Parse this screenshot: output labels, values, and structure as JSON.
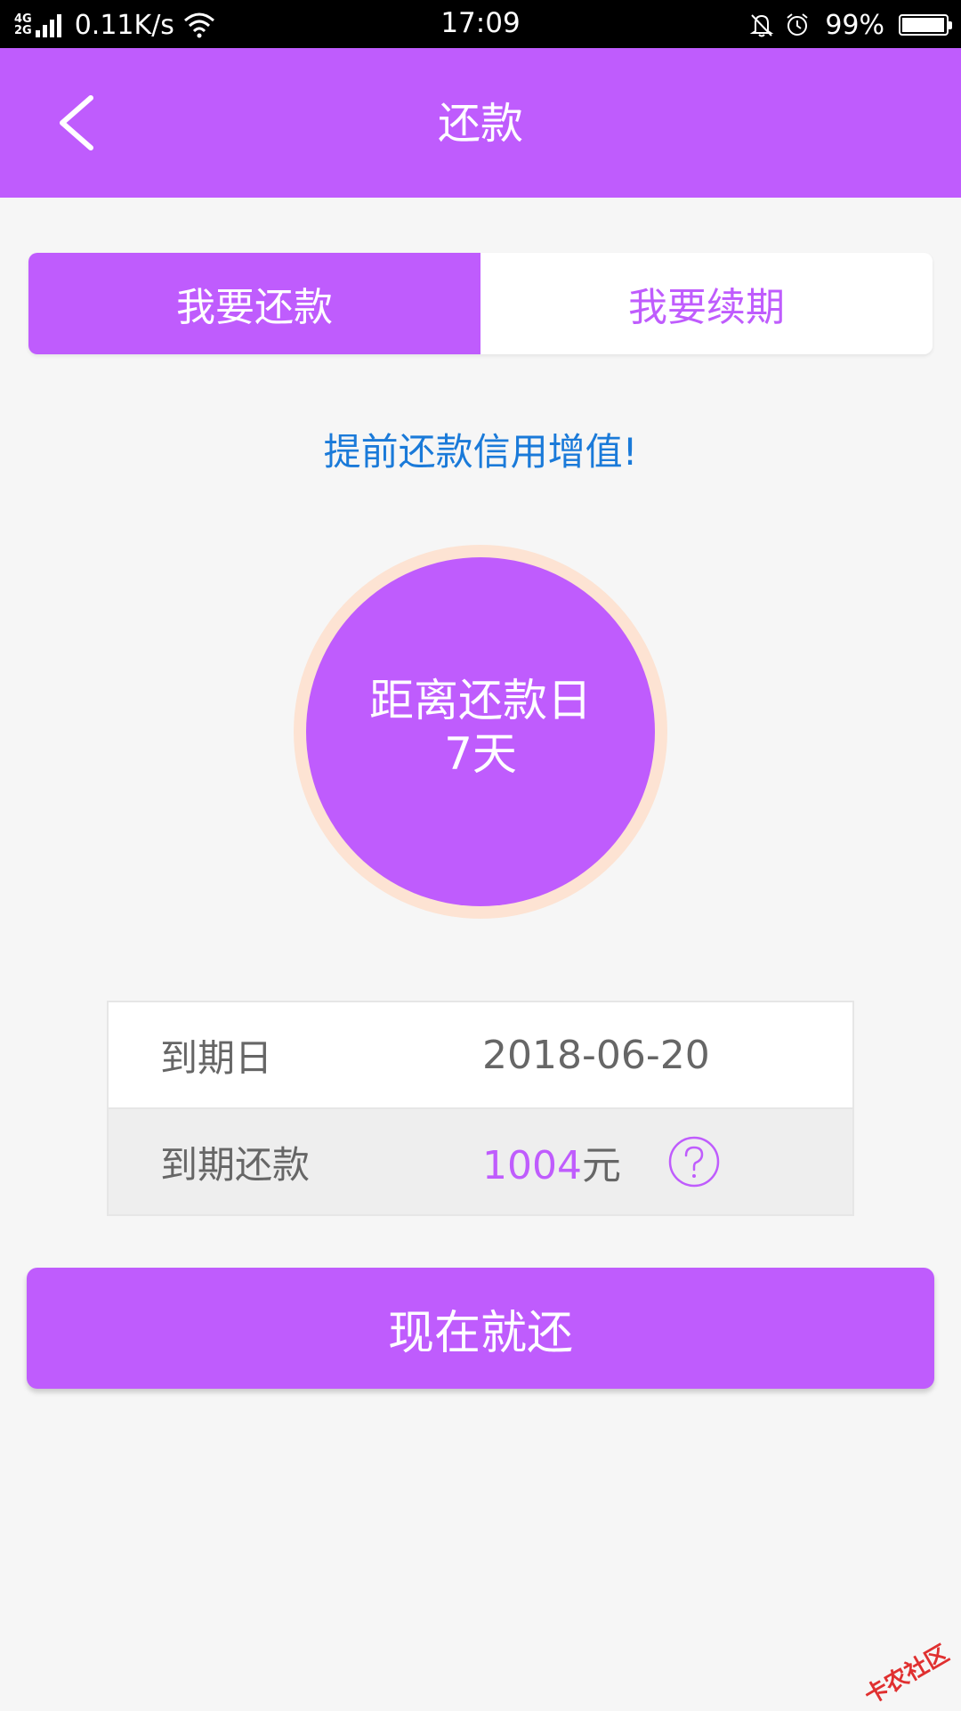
{
  "status_bar": {
    "network_top": "4G",
    "network_bottom": "2G",
    "speed": "0.11K/s",
    "time": "17:09",
    "battery": "99%",
    "battery_level": 0.99,
    "icons": [
      "signal-icon",
      "wifi-icon",
      "mute-bell-icon",
      "alarm-icon",
      "battery-icon"
    ]
  },
  "header": {
    "title": "还款",
    "back_icon": "chevron-left-icon"
  },
  "tabs": [
    {
      "label": "我要还款",
      "active": true
    },
    {
      "label": "我要续期",
      "active": false
    }
  ],
  "promo_text": "提前还款信用增值!",
  "countdown": {
    "line1": "距离还款日",
    "line2": "7天"
  },
  "details": {
    "due_date_label": "到期日",
    "due_date_value": "2018-06-20",
    "amount_label": "到期还款",
    "amount_number": "1004",
    "amount_unit": "元",
    "help_icon": "question-circle-icon"
  },
  "pay_button": "现在就还",
  "watermark": "卡农社区",
  "colors": {
    "brand": "#bf5cfd",
    "promo": "#1a7ad9",
    "circle_ring": "#fde3d3"
  }
}
